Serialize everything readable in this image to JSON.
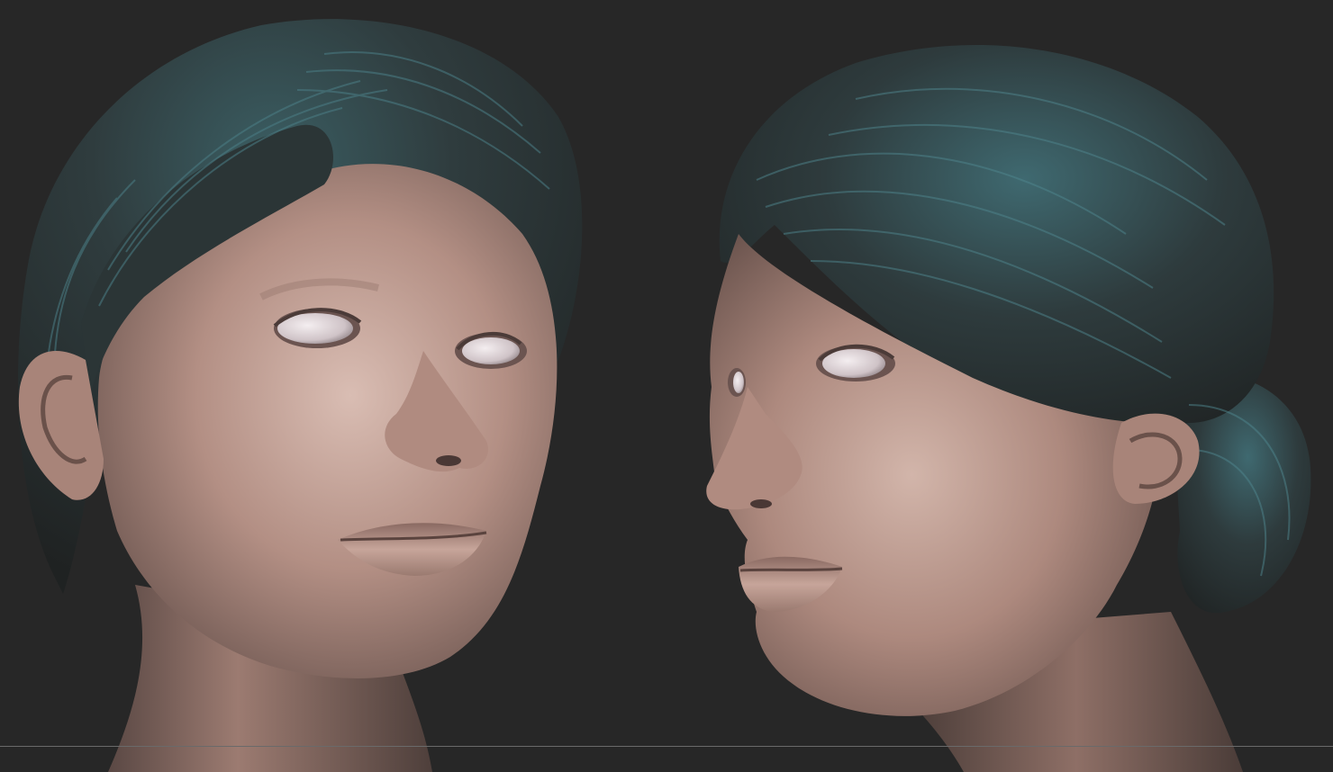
{
  "viewport": {
    "background": "#272727",
    "floor_line_color": "#6a6a6a"
  },
  "models": [
    {
      "name": "female-head-front-three-quarter",
      "skin_color": "#b8958a",
      "hair_color": "#2f3030",
      "hair_highlight": "#3f6b72",
      "eye_color": "#e6dde0"
    },
    {
      "name": "female-head-side-three-quarter",
      "skin_color": "#b8958a",
      "hair_color": "#2f3030",
      "hair_highlight": "#3f6b72",
      "eye_color": "#e6dde0"
    }
  ]
}
